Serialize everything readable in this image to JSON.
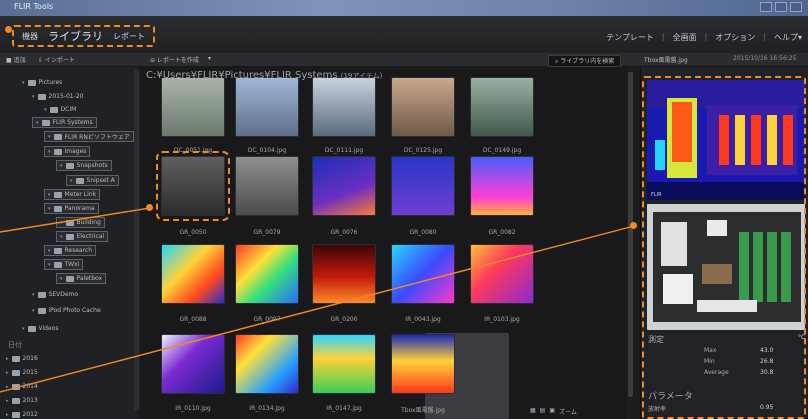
{
  "window": {
    "title": "FLIR Tools"
  },
  "menu": {
    "left": [
      "機器",
      "ライブラリ",
      "レポート"
    ],
    "active_index": 1,
    "right": [
      "テンプレート",
      "全画面",
      "オプション",
      "ヘルプ▾"
    ]
  },
  "toolbar": {
    "items": [
      "■ 追加",
      "⇩ インポート",
      "⊖ レポートを作成",
      "▾"
    ],
    "search_placeholder": "ライブラリ内を検索",
    "file_name": "Tbox風電盤.jpg",
    "datetime": "2015/10/16 16:56:25"
  },
  "tree": {
    "nodes": [
      {
        "label": "Pictures",
        "level": 1,
        "boxed": false
      },
      {
        "label": "2015-01-20",
        "level": 2,
        "boxed": false
      },
      {
        "label": "DCIM",
        "level": 3,
        "boxed": false
      },
      {
        "label": "FLIR Systems",
        "level": 2,
        "boxed": true
      },
      {
        "label": "FLIR RNビソフトウェア",
        "level": 3,
        "boxed": true
      },
      {
        "label": "Images",
        "level": 3,
        "boxed": true
      },
      {
        "label": "Snapshots",
        "level": 4,
        "boxed": true
      },
      {
        "label": "Snipset A",
        "level": 5,
        "boxed": true
      },
      {
        "label": "Meter Link",
        "level": 3,
        "boxed": true
      },
      {
        "label": "Panorama",
        "level": 3,
        "boxed": true
      },
      {
        "label": "Building",
        "level": 4,
        "boxed": true
      },
      {
        "label": "Electrical",
        "level": 4,
        "boxed": true
      },
      {
        "label": "Research",
        "level": 3,
        "boxed": true
      },
      {
        "label": "TWxi",
        "level": 3,
        "boxed": true
      },
      {
        "label": "Paletbox",
        "level": 4,
        "boxed": true
      },
      {
        "label": "SEVDemo",
        "level": 2,
        "boxed": false
      },
      {
        "label": "iPod Photo Cache",
        "level": 2,
        "boxed": false
      },
      {
        "label": "Videos",
        "level": 1,
        "boxed": false
      }
    ],
    "date_section": "日付",
    "years": [
      "2016",
      "2015",
      "2014",
      "2013",
      "2012"
    ]
  },
  "path": {
    "text": "C:¥Users¥FLIR¥Pictures¥FLIR Systems",
    "count": "(19アイテム)"
  },
  "thumbnails": [
    {
      "label": "DC_0051.jpg",
      "palette": "photo1"
    },
    {
      "label": "DC_0104.jpg",
      "palette": "photo2"
    },
    {
      "label": "DC_0111.jpg",
      "palette": "photo3"
    },
    {
      "label": "DC_0125.jpg",
      "palette": "photo4"
    },
    {
      "label": "DC_0149.jpg",
      "palette": "photo5"
    },
    {
      "label": "GR_0050",
      "palette": "gray1",
      "selected": true
    },
    {
      "label": "GR_0079",
      "palette": "gray2"
    },
    {
      "label": "GR_0076",
      "palette": "ir_line"
    },
    {
      "label": "GR_0080",
      "palette": "ir_tower"
    },
    {
      "label": "GR_0082",
      "palette": "ir_line2"
    },
    {
      "label": "GR_0088",
      "palette": "ir_sub"
    },
    {
      "label": "GR_0097",
      "palette": "ir_rainbow"
    },
    {
      "label": "GR_0200",
      "palette": "ir_red"
    },
    {
      "label": "IR_0043.jpg",
      "palette": "ir_blue"
    },
    {
      "label": "IR_0103.jpg",
      "palette": "ir_hand"
    },
    {
      "label": "IR_0110.jpg",
      "palette": "ir_purple"
    },
    {
      "label": "IR_0134.jpg",
      "palette": "ir_pipe"
    },
    {
      "label": "IR_0147.jpg",
      "palette": "ir_spots"
    },
    {
      "label": "Tbox風電盤.jpg",
      "palette": "ir_panel"
    }
  ],
  "bottom": {
    "zoom_label": "ズーム",
    "icons": [
      "grid-icon",
      "list-icon",
      "thumb-icon"
    ]
  },
  "right_panel": {
    "measure_title": "測定",
    "measure_unit": "°C",
    "rows": [
      {
        "key": "Max",
        "value": "43.0"
      },
      {
        "key": "Min",
        "value": "26.8"
      },
      {
        "key": "Average",
        "value": "30.8"
      }
    ],
    "param_title": "パラメータ",
    "param_rows": [
      {
        "key": "放射率",
        "value": "0.95"
      }
    ]
  },
  "colors": {
    "accent": "#f08a24",
    "bg": "#1c1d1f"
  }
}
